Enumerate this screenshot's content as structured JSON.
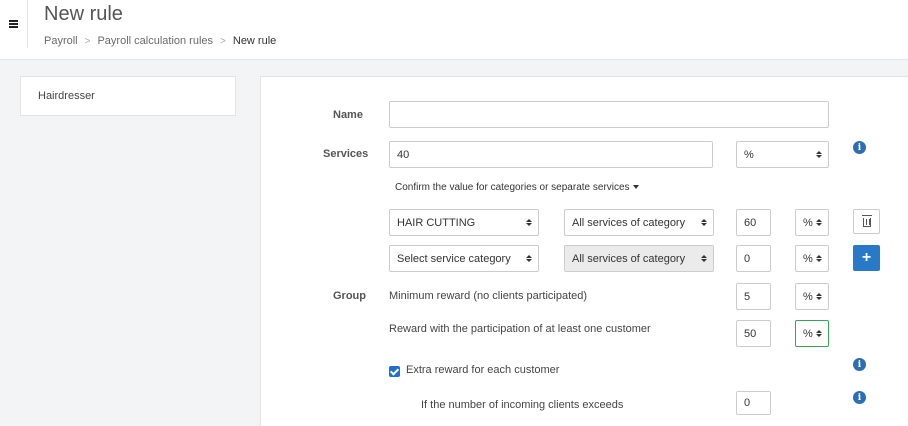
{
  "header": {
    "title": "New rule",
    "breadcrumb": [
      "Payroll",
      "Payroll calculation rules",
      "New rule"
    ],
    "separator": ">"
  },
  "sidebar": {
    "item": "Hairdresser"
  },
  "form": {
    "name_label": "Name",
    "name_value": "",
    "services_label": "Services",
    "services_value": "40",
    "services_unit": "%",
    "confirm_link": "Confirm the value for categories or separate services",
    "rows": [
      {
        "category": "HAIR CUTTING",
        "scope": "All services of category",
        "value": "60",
        "unit": "%"
      },
      {
        "category": "Select service category",
        "scope": "All services of category",
        "value": "0",
        "unit": "%"
      }
    ],
    "group_label": "Group",
    "min_reward_label": "Minimum reward (no clients participated)",
    "min_reward_value": "5",
    "min_reward_unit": "%",
    "participation_label": "Reward with the participation of at least one customer",
    "participation_value": "50",
    "participation_unit": "%",
    "extra_reward_label": "Extra reward for each customer",
    "extra_reward_checked": true,
    "clients_exceed_label": "If the number of incoming clients exceeds",
    "clients_exceed_value": "0",
    "add_symbol": "+",
    "info_symbol": "i"
  },
  "colors": {
    "accent": "#2879c7",
    "info": "#2d6db3",
    "checkbox": "#1f6fd1",
    "focus_border": "#39a25f"
  }
}
